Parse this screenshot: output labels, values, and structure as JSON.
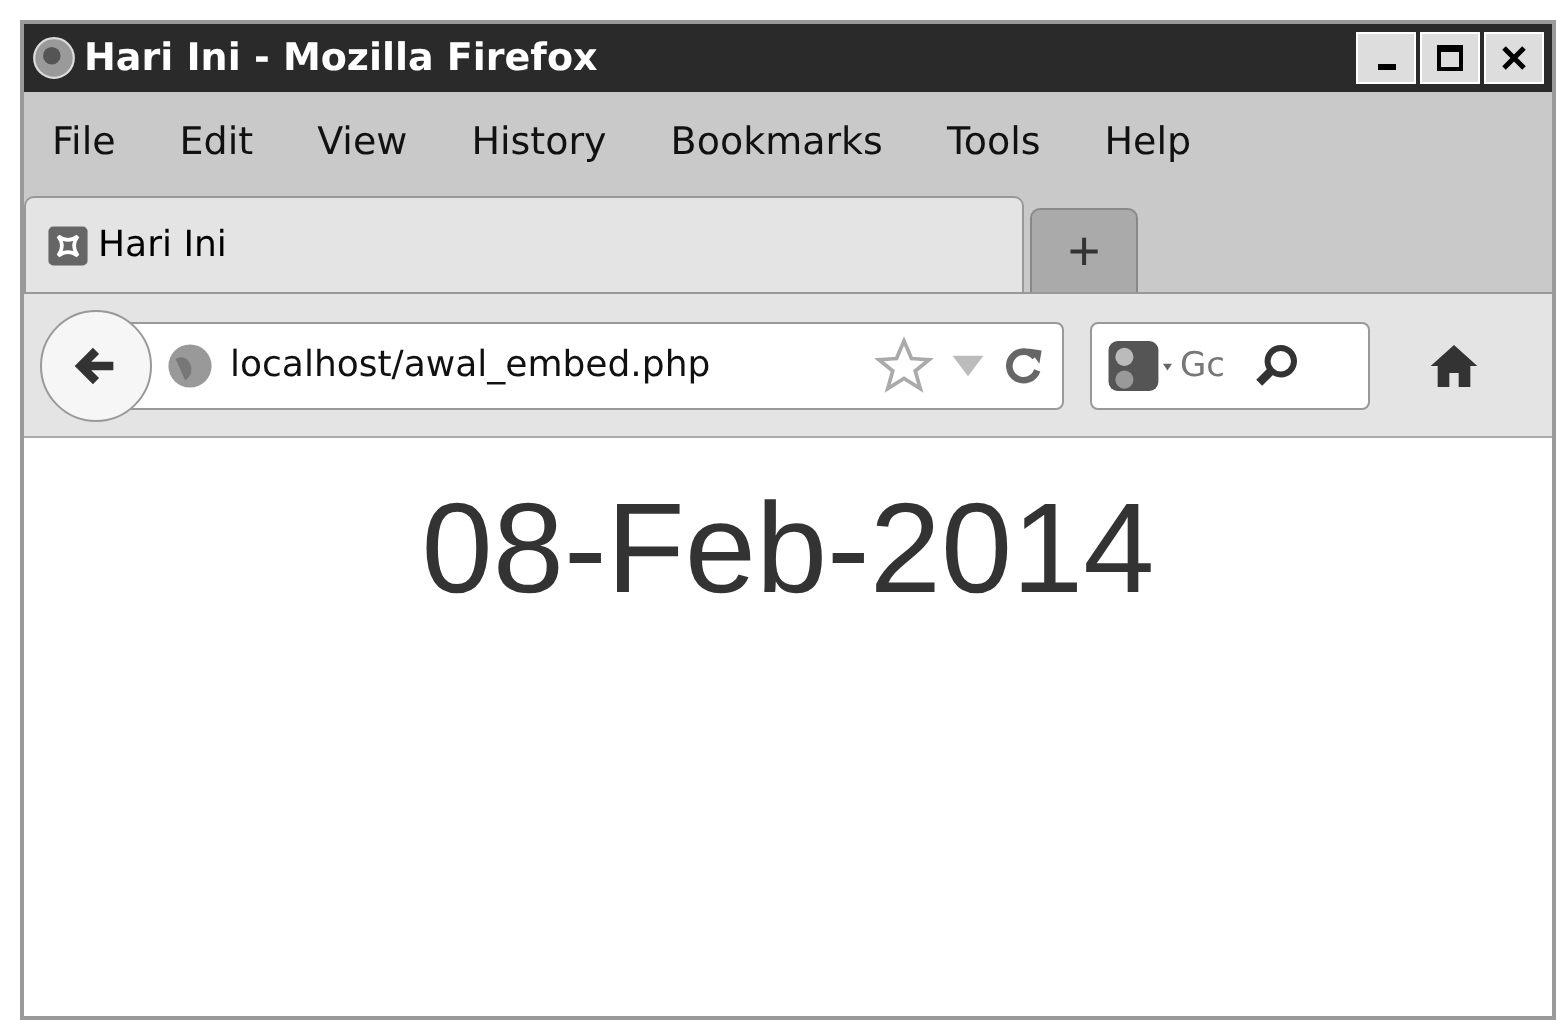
{
  "window": {
    "title": "Hari Ini - Mozilla Firefox"
  },
  "menu": [
    "File",
    "Edit",
    "View",
    "History",
    "Bookmarks",
    "Tools",
    "Help"
  ],
  "tabs": [
    {
      "label": "Hari Ini",
      "selected": true
    }
  ],
  "new_tab": "+",
  "address": {
    "value": "localhost/awal_embed.php",
    "bookmarked": false
  },
  "search": {
    "placeholder": "Gc"
  },
  "page": {
    "heading": "08-Feb-2014"
  }
}
